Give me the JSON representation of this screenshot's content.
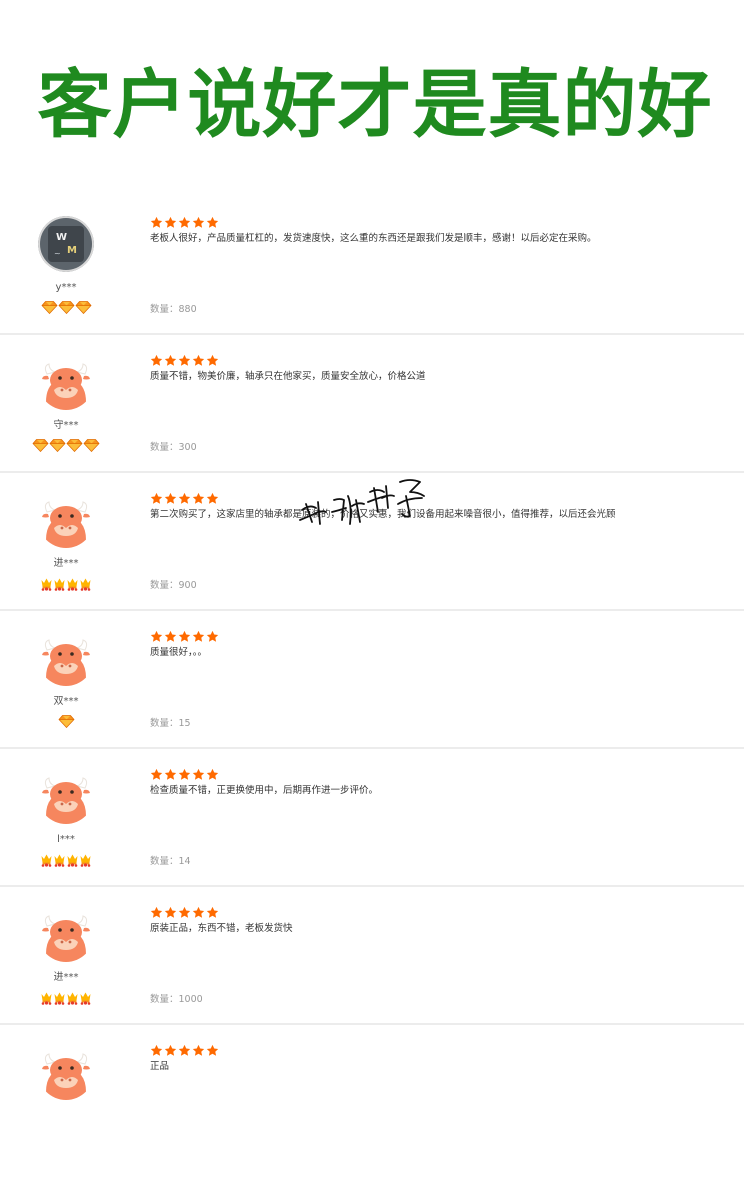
{
  "headline": "客户说好才是真的好",
  "watermark_text": "轴蝶轴承",
  "reviews": [
    {
      "user": "y***",
      "avatar": "photo-avatar",
      "stars": 5,
      "level_icon": "diamond-icon",
      "level_count": 3,
      "comment": "老板人很好，产品质量杠杠的，发货速度快，这么重的东西还是跟我们发是顺丰，感谢！以后必定在采购。",
      "quantity": "数量：880"
    },
    {
      "user": "守***",
      "avatar": "bull-avatar",
      "stars": 5,
      "level_icon": "diamond-icon",
      "level_count": 4,
      "comment": "质量不错，物美价廉，轴承只在他家买，质量安全放心，价格公道",
      "quantity": "数量：300"
    },
    {
      "user": "进***",
      "avatar": "bull-avatar",
      "stars": 5,
      "level_icon": "crown-icon",
      "level_count": 4,
      "comment": "第二次购买了，这家店里的轴承都是原装的，价格又实惠，我们设备用起来噪音很小，值得推荐，以后还会光顾",
      "quantity": "数量：900"
    },
    {
      "user": "双***",
      "avatar": "bull-avatar",
      "stars": 5,
      "level_icon": "diamond-icon",
      "level_count": 1,
      "comment": "质量很好，。。",
      "quantity": "数量：15"
    },
    {
      "user": "l***",
      "avatar": "bull-avatar",
      "stars": 5,
      "level_icon": "crown-icon",
      "level_count": 4,
      "comment": "检查质量不错，正更换使用中，后期再作进一步评价。",
      "quantity": "数量：14"
    },
    {
      "user": "进***",
      "avatar": "bull-avatar",
      "stars": 5,
      "level_icon": "crown-icon",
      "level_count": 4,
      "comment": "原装正品，东西不错，老板发货快",
      "quantity": "数量：1000"
    },
    {
      "user": "",
      "avatar": "bull-avatar",
      "stars": 5,
      "level_icon": "",
      "level_count": 0,
      "comment": "正品",
      "quantity": ""
    }
  ],
  "colors": {
    "headline": "#1f8a1f",
    "star": "#ff6a00",
    "bull": "#f6865e",
    "divider": "#ececec"
  }
}
